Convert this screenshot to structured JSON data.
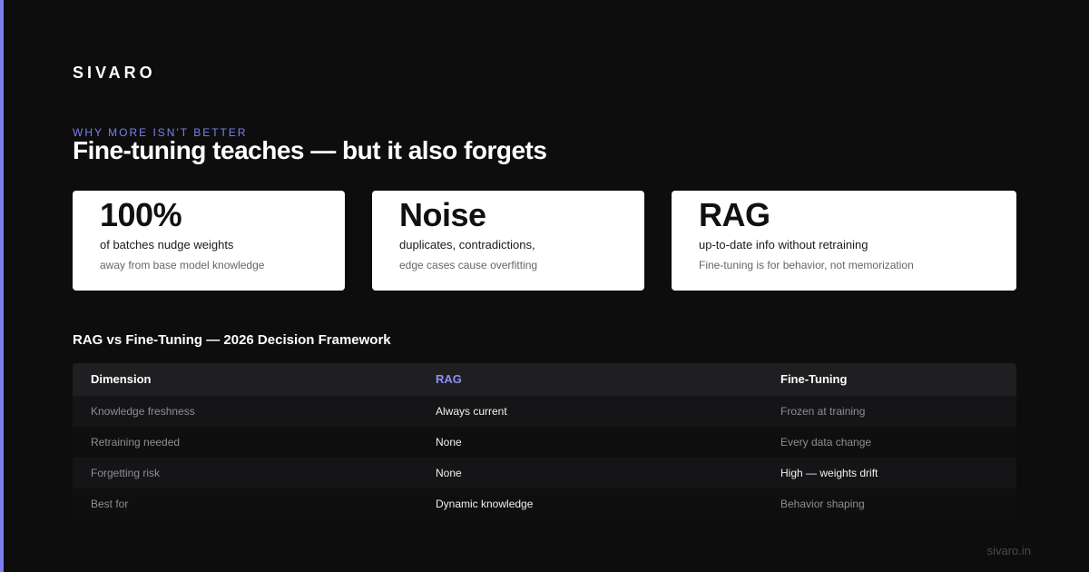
{
  "brand": "SIVARO",
  "eyebrow": "WHY MORE ISN'T BETTER",
  "headline": "Fine-tuning teaches — but it also forgets",
  "cards": [
    {
      "stat": "100%",
      "desc": "of batches nudge weights",
      "sub": "away from base model knowledge"
    },
    {
      "stat": "Noise",
      "desc": "duplicates, contradictions,",
      "sub": "edge cases cause overfitting"
    },
    {
      "stat": "RAG",
      "desc": "up-to-date info without retraining",
      "sub": "Fine-tuning is for behavior, not memorization"
    }
  ],
  "table": {
    "title": "RAG vs Fine-Tuning — 2026 Decision Framework",
    "headers": [
      "Dimension",
      "RAG",
      "Fine-Tuning"
    ],
    "rows": [
      [
        "Knowledge freshness",
        "Always current",
        "Frozen at training"
      ],
      [
        "Retraining needed",
        "None",
        "Every data change"
      ],
      [
        "Forgetting risk",
        "None",
        "High — weights drift"
      ],
      [
        "Best for",
        "Dynamic knowledge",
        "Behavior shaping"
      ]
    ]
  },
  "footer": "sivaro.in",
  "colors": {
    "accent": "#7b7ff0",
    "background": "#0d0d0d",
    "card": "#ffffff"
  }
}
